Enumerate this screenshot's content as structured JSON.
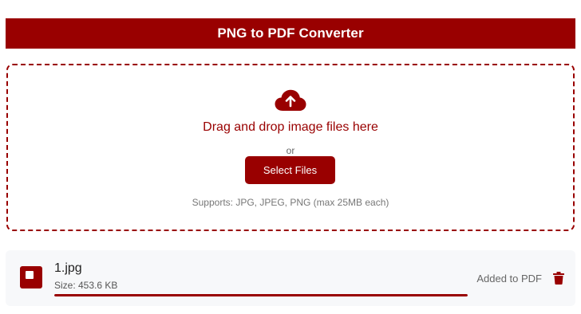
{
  "header": {
    "title": "PNG to PDF Converter"
  },
  "dropzone": {
    "icon": "cloud-upload-icon",
    "title": "Drag and drop image files here",
    "or_text": "or",
    "select_button_label": "Select Files",
    "supports_text": "Supports: JPG, JPEG, PNG (max 25MB each)"
  },
  "files": [
    {
      "icon": "image-file-icon",
      "name": "1.jpg",
      "size_text": "Size: 453.6 KB",
      "progress": 1.0,
      "status": "Added to PDF",
      "delete_icon": "trash-icon"
    }
  ],
  "colors": {
    "accent": "#990000",
    "page_background": "#ffffff",
    "file_row_background": "#f7f8fa"
  }
}
